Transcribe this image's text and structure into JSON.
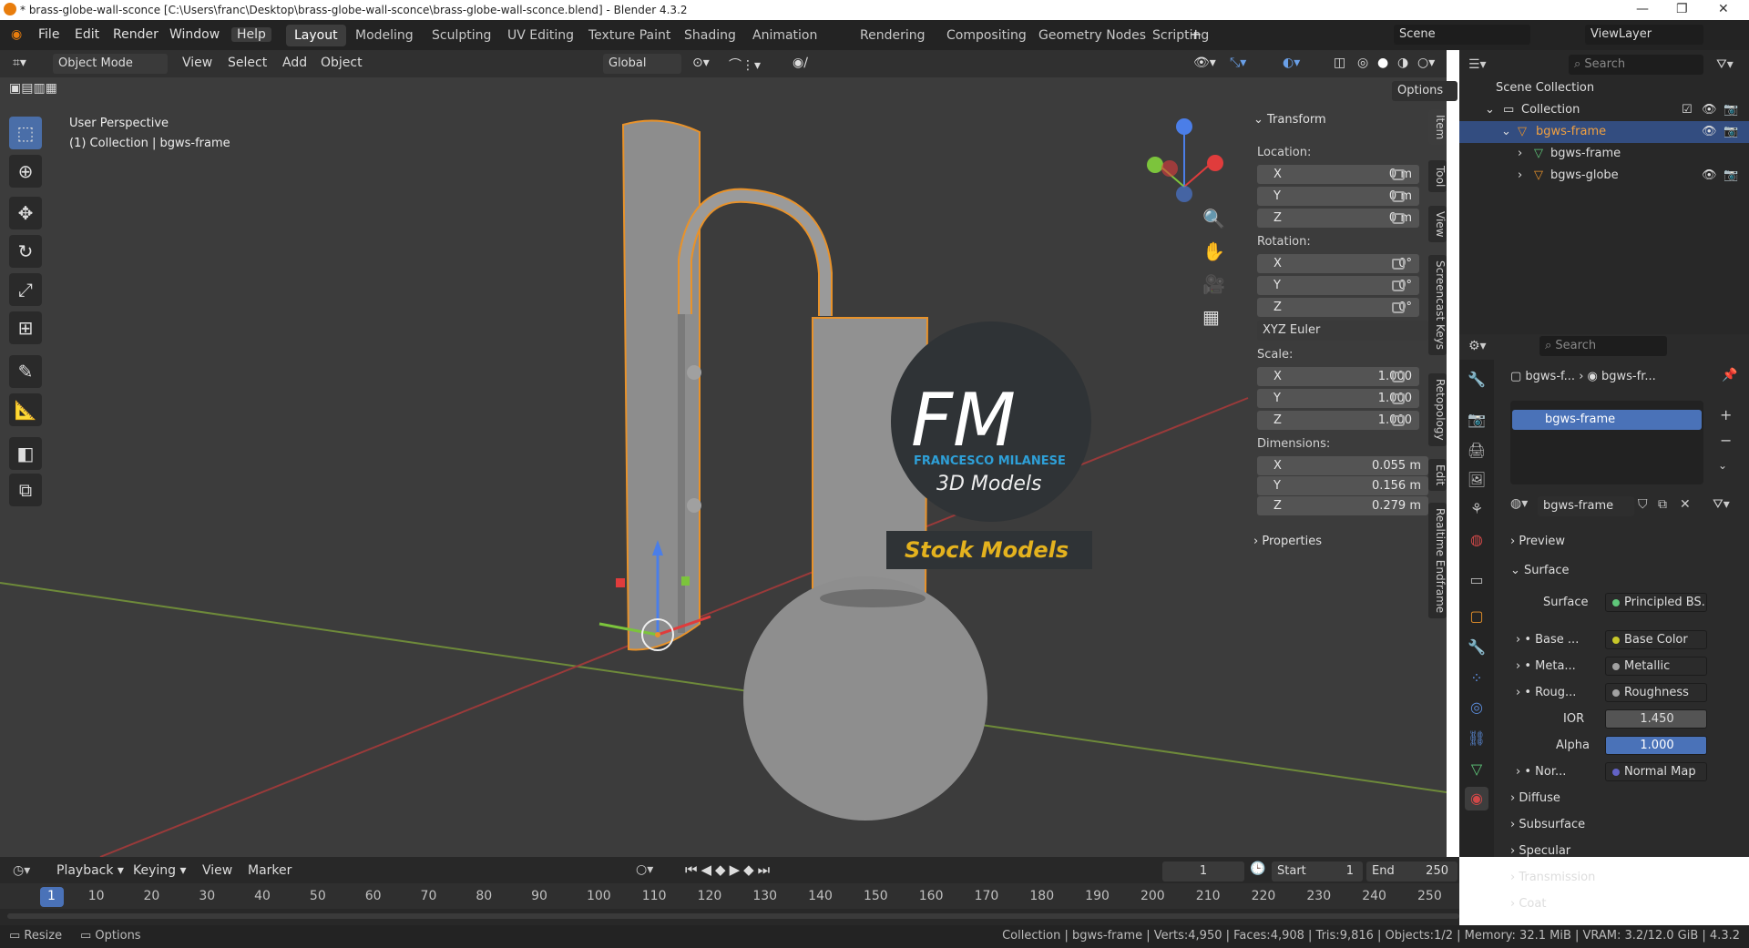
{
  "window": {
    "title": "* brass-globe-wall-sconce [C:\\Users\\franc\\Desktop\\brass-globe-wall-sconce\\brass-globe-wall-sconce.blend] - Blender 4.3.2",
    "minimize": "—",
    "maximize": "❐",
    "close": "✕"
  },
  "menus": [
    "File",
    "Edit",
    "Render",
    "Window",
    "Help"
  ],
  "workspaces": [
    "Layout",
    "Modeling",
    "Sculpting",
    "UV Editing",
    "Texture Paint",
    "Shading",
    "Animation",
    "Rendering",
    "Compositing",
    "Geometry Nodes",
    "Scripting"
  ],
  "scene": "Scene",
  "view_layer": "ViewLayer",
  "viewport_header": {
    "mode": "Object Mode",
    "menus": [
      "View",
      "Select",
      "Add",
      "Object"
    ],
    "orientation": "Global",
    "options": "Options"
  },
  "overlay_text": {
    "perspective": "User Perspective",
    "collection": "(1) Collection | bgws-frame"
  },
  "watermark": {
    "logo": "FM",
    "company": "FRANCESCO MILANESE",
    "line1": "3D Models",
    "line2": "Stock Models"
  },
  "npanel": {
    "tabs": [
      "Item",
      "Tool",
      "View",
      "Screencast Keys",
      "Retopology",
      "Edit",
      "Realtime Endframe"
    ],
    "transform": "Transform",
    "location_label": "Location:",
    "location": {
      "x": "0 m",
      "y": "0 m",
      "z": "0 m"
    },
    "rotation_label": "Rotation:",
    "rotation": {
      "x": "0°",
      "y": "0°",
      "z": "0°"
    },
    "rotation_mode": "XYZ Euler",
    "scale_label": "Scale:",
    "scale": {
      "x": "1.000",
      "y": "1.000",
      "z": "1.000"
    },
    "dimensions_label": "Dimensions:",
    "dimensions": {
      "x": "0.055 m",
      "y": "0.156 m",
      "z": "0.279 m"
    },
    "properties": "Properties",
    "axis": {
      "x": "X",
      "y": "Y",
      "z": "Z"
    }
  },
  "outliner": {
    "search": "Search",
    "rows": [
      "Scene Collection",
      "Collection",
      "bgws-frame",
      "bgws-frame",
      "bgws-globe"
    ]
  },
  "properties": {
    "search": "Search",
    "breadcrumb": [
      "bgws-f...",
      "bgws-fr..."
    ],
    "material_slot": "bgws-frame",
    "material_name": "bgws-frame",
    "preview": "Preview",
    "surface_section": "Surface",
    "surface_label": "Surface",
    "surface_value": "Principled BS...",
    "inputs": [
      {
        "label": "Base ...",
        "value": "Base Color",
        "color": "#c7c729"
      },
      {
        "label": "Meta...",
        "value": "Metallic",
        "color": "#a1a1a1"
      },
      {
        "label": "Roug...",
        "value": "Roughness",
        "color": "#a1a1a1"
      },
      {
        "label": "IOR",
        "value": "1.450",
        "color": "#a1a1a1"
      },
      {
        "label": "Alpha",
        "value": "1.000",
        "color": "#a1a1a1"
      },
      {
        "label": "Nor...",
        "value": "Normal Map",
        "color": "#6363c7"
      }
    ],
    "sections": [
      "Diffuse",
      "Subsurface",
      "Specular",
      "Transmission",
      "Coat"
    ]
  },
  "timeline": {
    "menus": [
      "Playback",
      "Keying",
      "View",
      "Marker"
    ],
    "current_frame": "1",
    "start_label": "Start",
    "start": "1",
    "end_label": "End",
    "end": "250",
    "ticks": [
      "1",
      "10",
      "20",
      "30",
      "40",
      "50",
      "60",
      "70",
      "80",
      "90",
      "100",
      "110",
      "120",
      "130",
      "140",
      "150",
      "160",
      "170",
      "180",
      "190",
      "200",
      "210",
      "220",
      "230",
      "240",
      "250"
    ]
  },
  "statusbar": {
    "left1": "Resize",
    "left2": "Options",
    "right": "Collection | bgws-frame | Verts:4,950 | Faces:4,908 | Tris:9,816 | Objects:1/2 | Memory: 32.1 MiB | VRAM: 3.2/12.0 GiB | 4.3.2"
  }
}
